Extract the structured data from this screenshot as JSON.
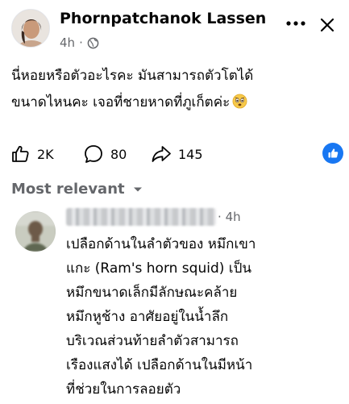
{
  "post": {
    "author": "Phornpatchanok Lassen",
    "time": "4h",
    "separator": "·",
    "privacy_icon": "globe-icon",
    "text_lines": [
      "นี่หอยหรือตัวอะไรคะ มันสามารถตัวโตได้",
      "ขนาดไหนคะ เจอที่ชายหาดที่ภูเก็ตค่ะ"
    ],
    "emoji_icon": "worried-face-emoji"
  },
  "reactions": {
    "like_count": "2K",
    "comment_count": "80",
    "share_count": "145"
  },
  "comments_section": {
    "sort_label": "Most relevant"
  },
  "comment": {
    "time": "4h",
    "separator": "·",
    "text_lines": [
      "เปลือกด้านในลำตัวของ หมึกเขา",
      "แกะ (Ram's horn squid) เป็น",
      "หมึกขนาดเล็กมีลักษณะคล้าย",
      "หมึกหูช้าง อาศัยอยู่ในน้ำลึก",
      "บริเวณส่วนท้ายลำตัวสามารถ",
      "เรืองแสงได้ เปลือกด้านในมีหน้า",
      "ที่ช่วยในการลอยตัว"
    ]
  },
  "colors": {
    "text_primary": "#050505",
    "text_secondary": "#65676b",
    "brand_blue": "#1877f2"
  }
}
